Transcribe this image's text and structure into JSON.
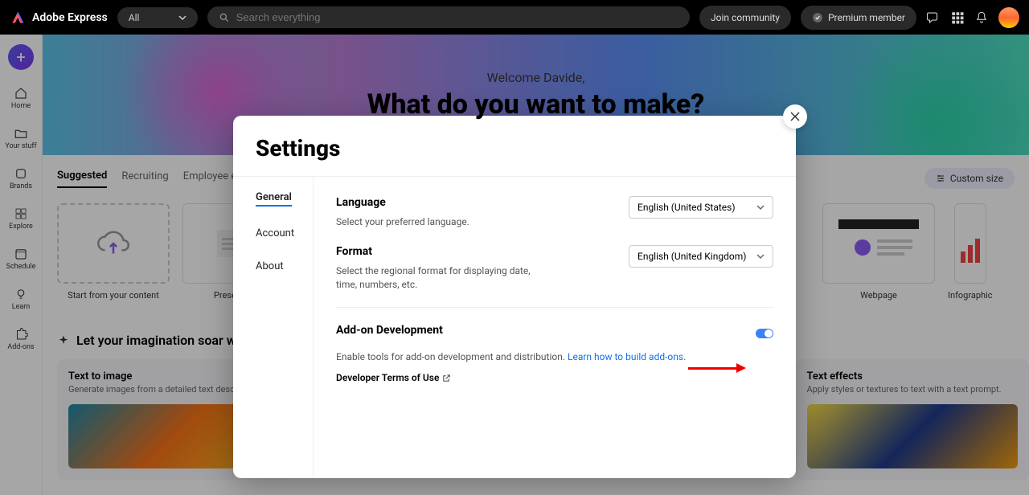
{
  "header": {
    "app_name": "Adobe Express",
    "filter_label": "All",
    "search_placeholder": "Search everything",
    "join_community": "Join community",
    "premium_member": "Premium member"
  },
  "sidebar": {
    "items": [
      {
        "label": "Home"
      },
      {
        "label": "Your stuff"
      },
      {
        "label": "Brands"
      },
      {
        "label": "Explore"
      },
      {
        "label": "Schedule"
      },
      {
        "label": "Learn"
      },
      {
        "label": "Add-ons"
      }
    ]
  },
  "hero": {
    "welcome": "Welcome Davide,",
    "title": "What do you want to make?"
  },
  "content_tabs": {
    "items": [
      "Suggested",
      "Recruiting",
      "Employee engagement"
    ],
    "custom_size": "Custom size"
  },
  "templates": [
    {
      "label": "Start from your content"
    },
    {
      "label": "Presentation"
    },
    {
      "label": "Webpage"
    },
    {
      "label": "Infographic"
    }
  ],
  "gen_ai": {
    "section_title": "Let your imagination soar with gene",
    "cards": [
      {
        "title": "Text to image",
        "sub": "Generate images from a detailed text description."
      },
      {
        "title": "Text effects",
        "sub": "Apply styles or textures to text with a text prompt."
      }
    ]
  },
  "modal": {
    "title": "Settings",
    "nav": [
      "General",
      "Account",
      "About"
    ],
    "language": {
      "title": "Language",
      "desc": "Select your preferred language.",
      "value": "English (United States)"
    },
    "format": {
      "title": "Format",
      "desc": "Select the regional format for displaying date, time, numbers, etc.",
      "value": "English (United Kingdom)"
    },
    "addon": {
      "title": "Add-on Development",
      "desc": "Enable tools for add-on development and distribution. ",
      "link": "Learn how to build add-ons.",
      "terms": "Developer Terms of Use"
    }
  }
}
